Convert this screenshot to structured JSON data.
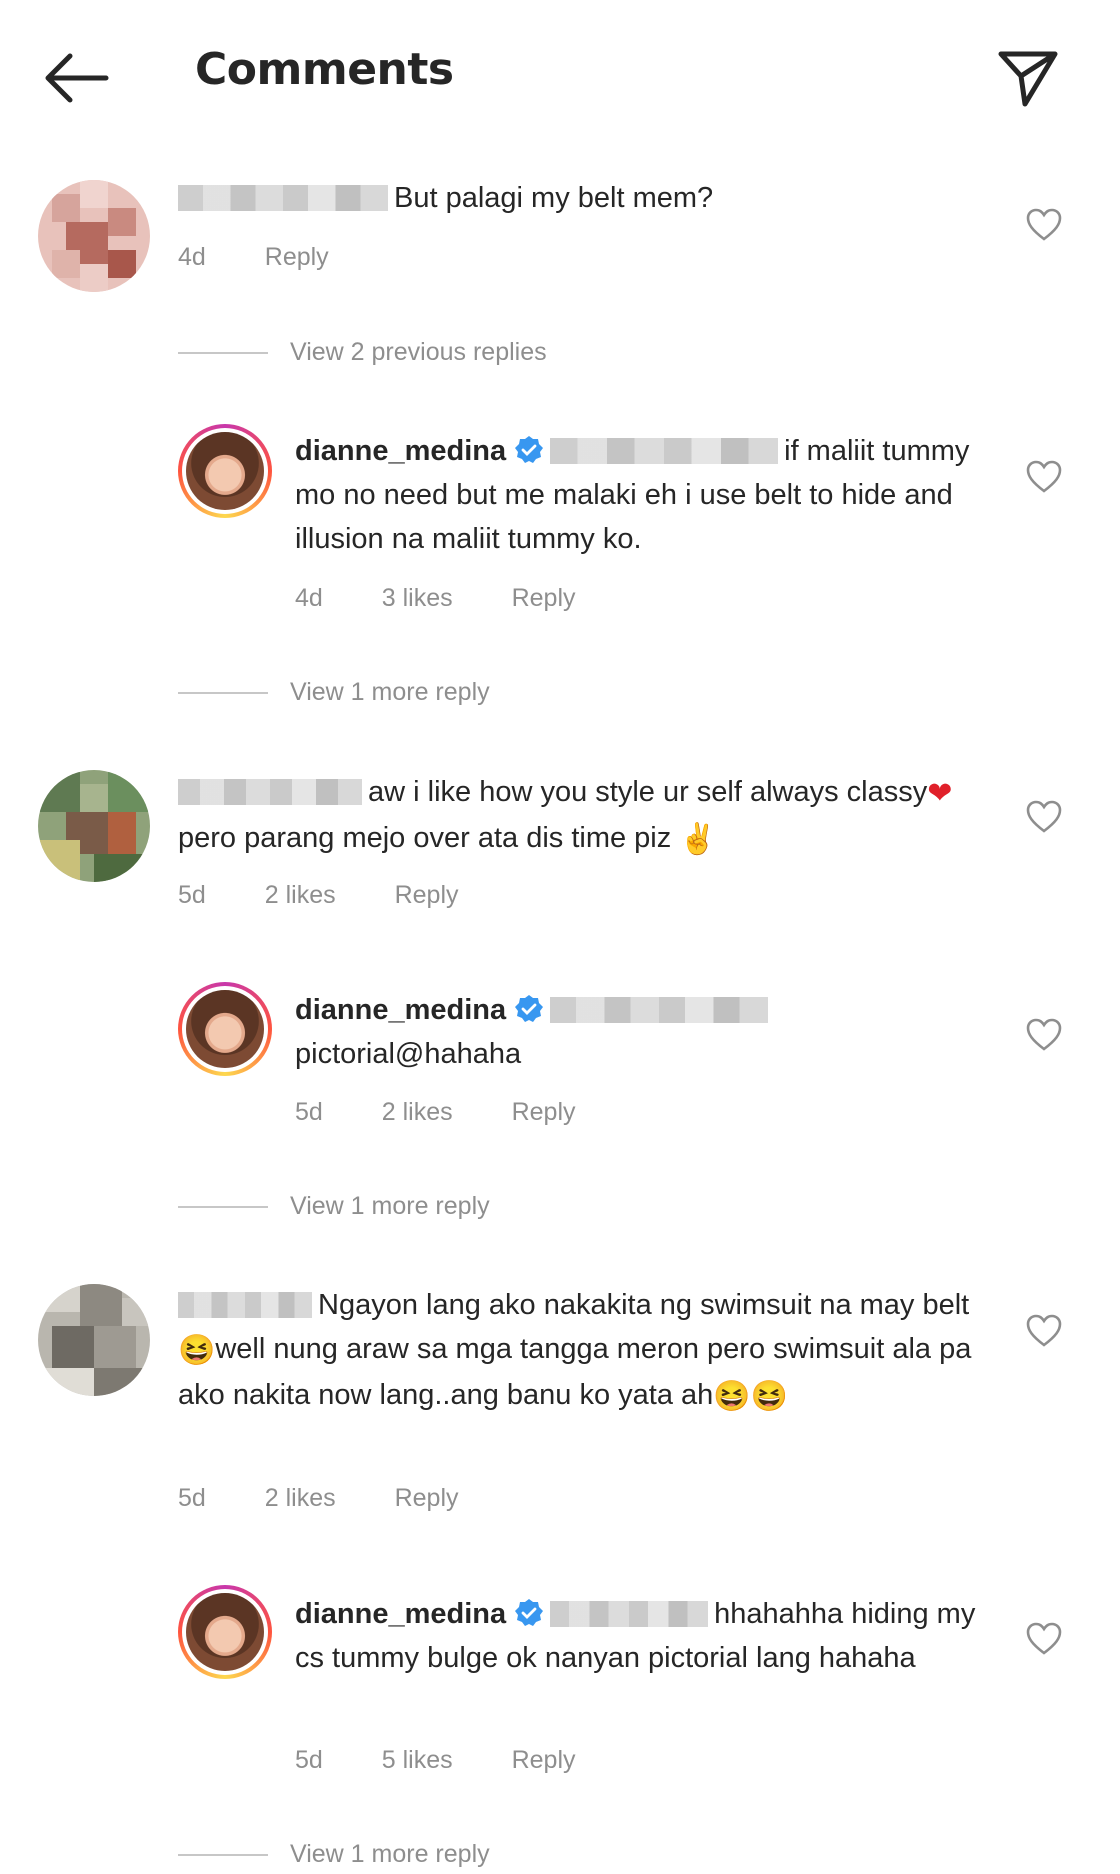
{
  "header": {
    "title": "Comments",
    "back_icon": "back-arrow-icon",
    "share_icon": "send-icon"
  },
  "colors": {
    "text": "#262626",
    "meta": "#8e8e8e",
    "verified": "#3897f0",
    "heart": "#8e8e8e"
  },
  "comments": [
    {
      "text": "But palagi my belt mem?",
      "time": "4d",
      "reply": "Reply",
      "view_replies": "View 2 previous replies",
      "replies": [
        {
          "username": "dianne_medina",
          "text": "if maliit tummy mo no need but me malaki eh i use belt to hide and illusion na maliit tummy ko.",
          "time": "4d",
          "likes": "3 likes",
          "reply": "Reply",
          "view_more": "View 1 more reply"
        }
      ]
    },
    {
      "text": "aw i like how you style ur self always classy",
      "text2": "pero parang mejo over ata dis time piz",
      "time": "5d",
      "likes": "2 likes",
      "reply": "Reply",
      "replies": [
        {
          "username": "dianne_medina",
          "text": "pictorial@hahaha",
          "time": "5d",
          "likes": "2 likes",
          "reply": "Reply",
          "view_more": "View 1 more reply"
        }
      ]
    },
    {
      "text": "Ngayon lang ako nakakita ng swimsuit na may belt",
      "text2": "well nung araw sa mga tangga meron pero swimsuit ala pa ako nakita now lang..ang banu ko yata ah",
      "time": "5d",
      "likes": "2 likes",
      "reply": "Reply",
      "replies": [
        {
          "username": "dianne_medina",
          "text": "hhahahha hiding my cs tummy bulge ok nanyan pictorial lang hahaha",
          "time": "5d",
          "likes": "5 likes",
          "reply": "Reply",
          "view_more": "View 1 more reply"
        }
      ]
    }
  ]
}
